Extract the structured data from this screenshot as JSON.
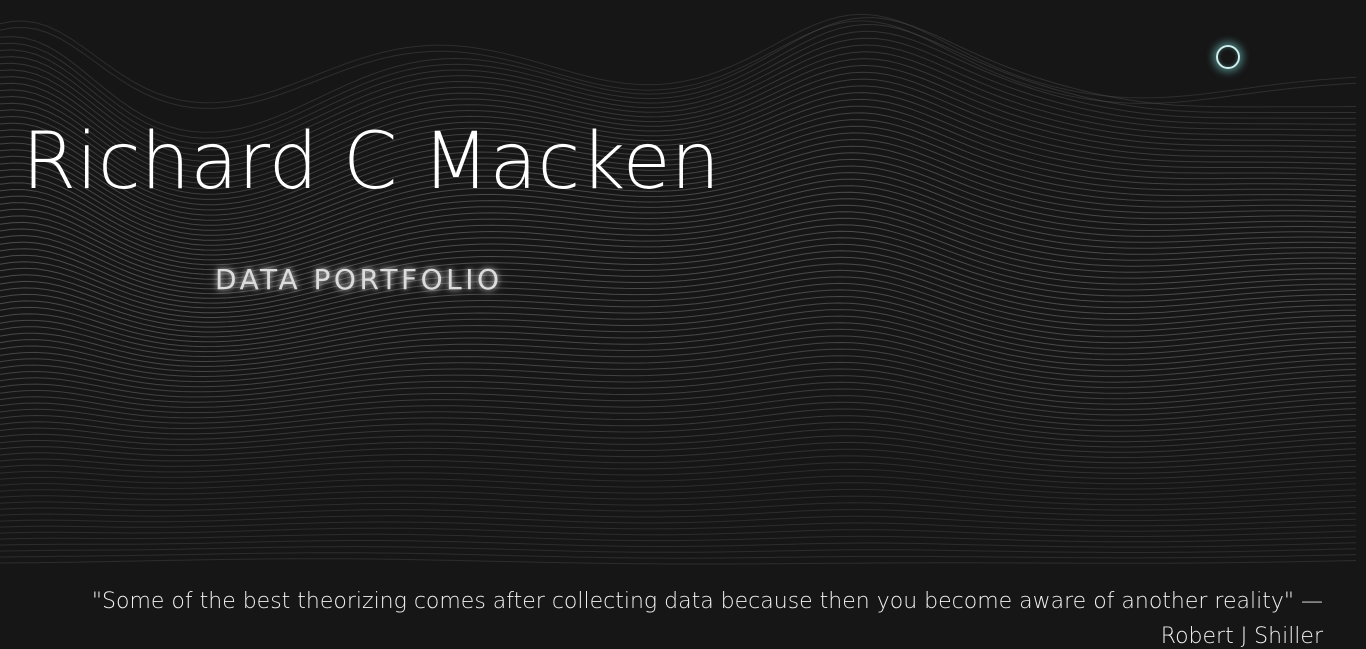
{
  "hero": {
    "name": "Richard C Macken",
    "subtitle": "DATA PORTFOLIO"
  },
  "quote": {
    "text": "\"Some of the best theorizing comes after collecting data because then you become aware of another reality\" —",
    "author": "Robert J Shiller"
  },
  "colors": {
    "background": "#161616",
    "lines": "#5a5a5a",
    "accent": "#cfeeee"
  },
  "icons": {
    "cursor": "circle-cursor-icon"
  }
}
